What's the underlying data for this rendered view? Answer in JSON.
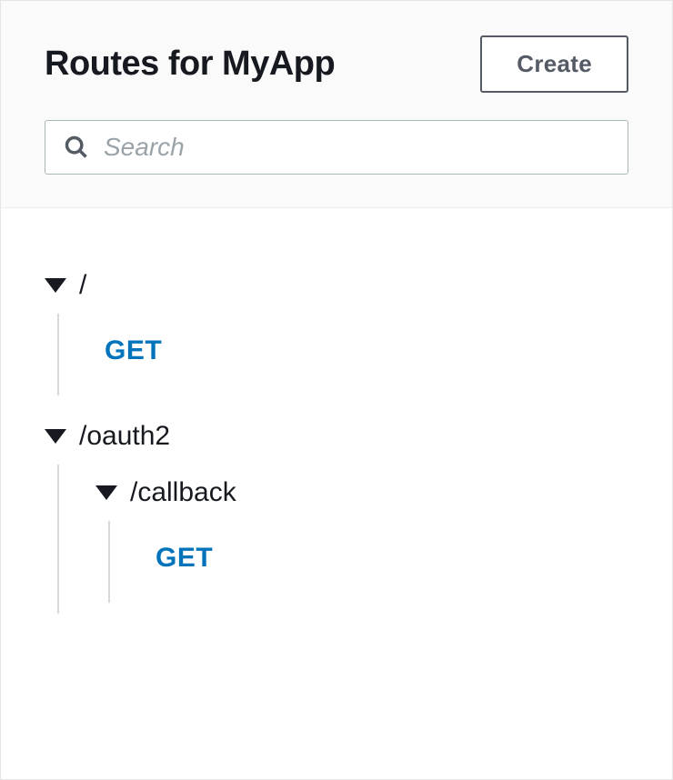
{
  "header": {
    "title": "Routes for MyApp",
    "create_label": "Create"
  },
  "search": {
    "placeholder": "Search",
    "value": ""
  },
  "routes": [
    {
      "path": "/",
      "methods": [
        "GET"
      ],
      "children": []
    },
    {
      "path": "/oauth2",
      "methods": [],
      "children": [
        {
          "path": "/callback",
          "methods": [
            "GET"
          ],
          "children": []
        }
      ]
    }
  ]
}
